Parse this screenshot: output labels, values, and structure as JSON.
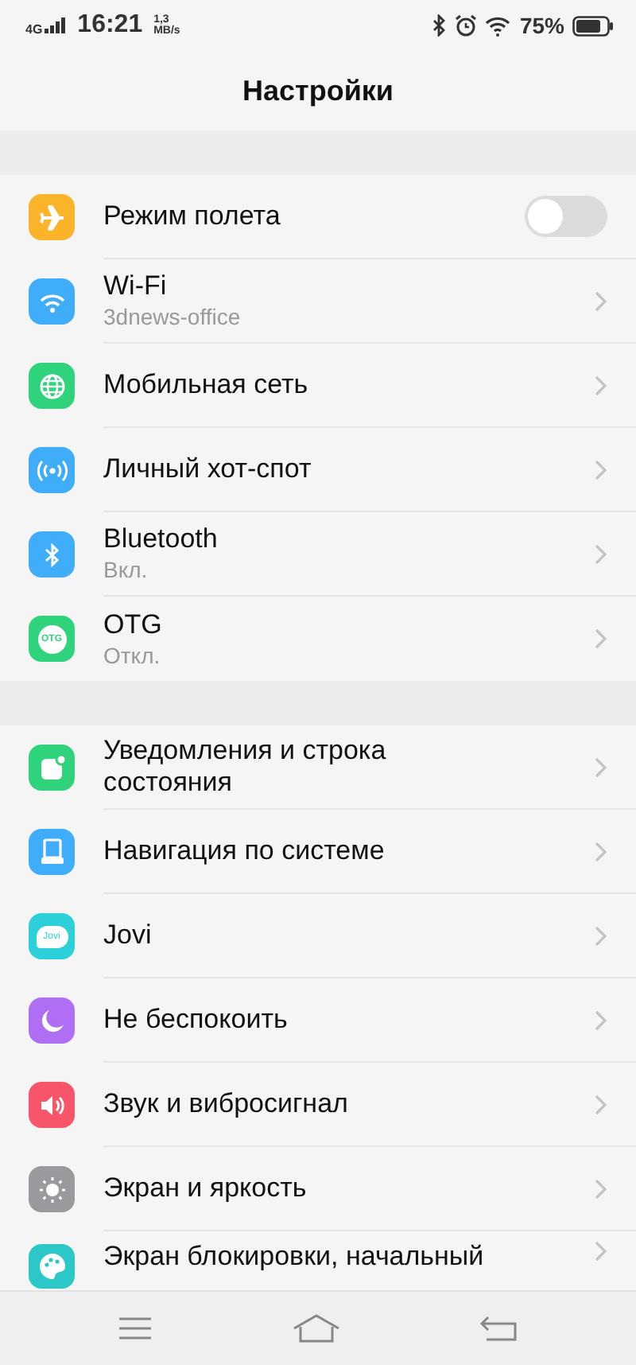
{
  "status_bar": {
    "network": "4G",
    "time": "16:21",
    "speed_value": "1,3",
    "speed_unit": "MB/s",
    "battery": "75%"
  },
  "header": {
    "title": "Настройки"
  },
  "groups": [
    {
      "items": [
        {
          "kind": "toggle",
          "title": "Режим полета",
          "on": false,
          "color": "#fbb32a"
        },
        {
          "kind": "link",
          "title": "Wi-Fi",
          "subtitle": "3dnews-office",
          "color": "#40adfb"
        },
        {
          "kind": "link",
          "title": "Мобильная сеть",
          "color": "#2fd37b"
        },
        {
          "kind": "link",
          "title": "Личный хот-спот",
          "color": "#40adfb"
        },
        {
          "kind": "link",
          "title": "Bluetooth",
          "subtitle": "Вкл.",
          "color": "#40adfb"
        },
        {
          "kind": "link",
          "title": "OTG",
          "subtitle": "Откл.",
          "icon_text": "OTG",
          "color": "#2fd37b"
        }
      ]
    },
    {
      "items": [
        {
          "kind": "link",
          "title": "Уведомления и строка состояния",
          "color": "#2fd37b"
        },
        {
          "kind": "link",
          "title": "Навигация по системе",
          "color": "#40adfb"
        },
        {
          "kind": "link",
          "title": "Jovi",
          "icon_text": "Jovi",
          "color": "#2cd0d8"
        },
        {
          "kind": "link",
          "title": "Не беспокоить",
          "color": "#b06ef5"
        },
        {
          "kind": "link",
          "title": "Звук и вибросигнал",
          "color": "#f7566a"
        },
        {
          "kind": "link",
          "title": "Экран и яркость",
          "color": "#9a9a9e"
        },
        {
          "kind": "link",
          "title": "Экран блокировки, начальный",
          "color": "#2cc8c8"
        }
      ]
    }
  ]
}
